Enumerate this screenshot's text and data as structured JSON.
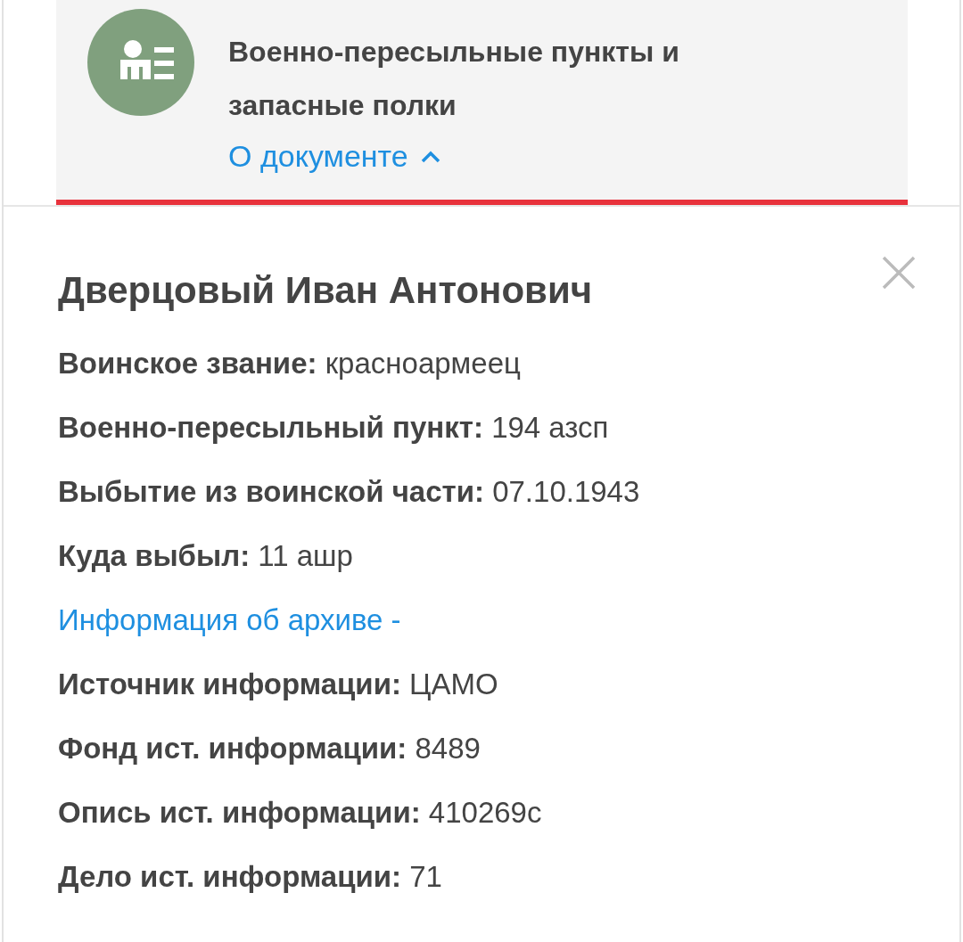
{
  "document_header": {
    "title": "Военно-пересыльные пункты и запасные полки",
    "about_link": {
      "label": "О документе",
      "expanded": true
    }
  },
  "record": {
    "name": "Дверцовый Иван Антонович",
    "fields": [
      {
        "kind": "field",
        "label": "Воинское звание:",
        "value": "красноармеец"
      },
      {
        "kind": "field",
        "label": "Военно-пересыльный пункт:",
        "value": "194 азсп"
      },
      {
        "kind": "field",
        "label": "Выбытие из воинской части:",
        "value": "07.10.1943"
      },
      {
        "kind": "field",
        "label": "Куда выбыл:",
        "value": "11 ашр"
      },
      {
        "kind": "link",
        "label": "Информация об архиве -"
      },
      {
        "kind": "field",
        "label": "Источник информации:",
        "value": "ЦАМО"
      },
      {
        "kind": "field",
        "label": "Фонд ист. информации:",
        "value": "8489"
      },
      {
        "kind": "field",
        "label": "Опись ист. информации:",
        "value": "410269с"
      },
      {
        "kind": "field",
        "label": "Дело ист. информации:",
        "value": "71"
      }
    ]
  }
}
